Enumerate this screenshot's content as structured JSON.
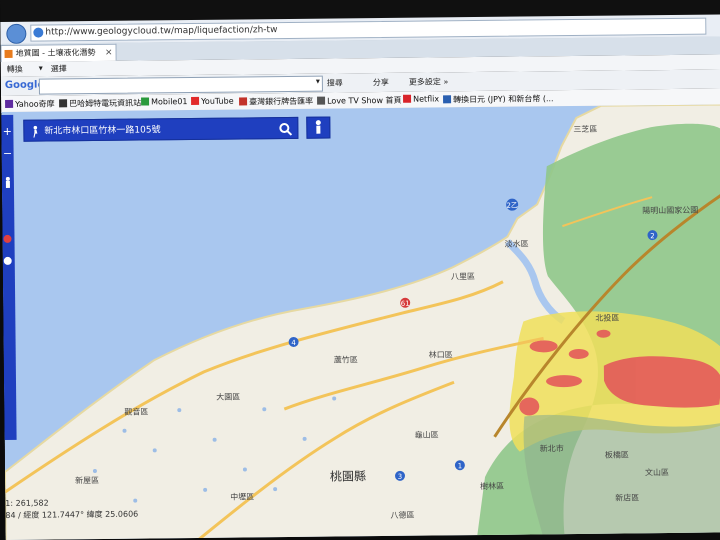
{
  "browser": {
    "url": "http://www.geologycloud.tw/map/liquefaction/zh-tw",
    "tab_title": "地質圖 - 土壤液化潛勢",
    "tab_close": "×"
  },
  "menu": {
    "items": [
      "轉換",
      "▾",
      "選擇"
    ]
  },
  "google_toolbar": {
    "logo": "Google",
    "search_dropdown": "▾",
    "search_label": "搜尋",
    "share_label": "分享",
    "more_label": "更多設定 »"
  },
  "favorites": [
    {
      "label": "Yahoo奇摩",
      "color": "#5f2ca0"
    },
    {
      "label": "巴哈姆特電玩資訊站",
      "color": "#333333"
    },
    {
      "label": "Mobile01",
      "color": "#2a9a3c"
    },
    {
      "label": "YouTube",
      "color": "#e22b2b"
    },
    {
      "label": "臺灣銀行牌告匯率",
      "color": "#c2332b"
    },
    {
      "label": "Love TV Show 首頁",
      "color": "#555555"
    },
    {
      "label": "Netflix",
      "color": "#d8232a"
    },
    {
      "label": "轉換日元 (JPY) 和新台幣 (...",
      "color": "#2a5fb0"
    }
  ],
  "map_ui": {
    "search_address": "新北市林口區竹林一路105號",
    "zoom_in": "+",
    "zoom_out": "−",
    "coords_line1": "1: 261,582",
    "coords_line2": "84 / 經度 121.7447° 緯度 25.0606"
  },
  "map_labels": {
    "sanzhi": "三芝區",
    "yangming_park": "陽明山國家公園",
    "tamsui": "淡水區",
    "bali": "八里區",
    "beitou": "北投區",
    "linkou": "林口區",
    "luzhu": "蘆竹區",
    "dayuan": "大園區",
    "guanyin": "觀音區",
    "xinwu": "新屋區",
    "guishan": "龜山區",
    "taoyuan_county": "桃園縣",
    "bade": "八德區",
    "zhongli": "中壢區",
    "banqiao": "板橋區",
    "shulin": "樹林區",
    "shin": "新北市",
    "xindian": "新店區",
    "wenshan": "文山區",
    "route_2": "2",
    "route_2a": "2乙",
    "route_61": "61",
    "route_4": "4",
    "route_1": "1",
    "route_3": "3",
    "route_15": "15"
  },
  "colors": {
    "sea": "#aac8f0",
    "land": "#f2efe6",
    "green_zone": "#8ec487",
    "yellow_risk": "#f2e35c",
    "red_risk": "#e85a5a",
    "highway": "#f5c65c",
    "map_panel": "#1f3fbf"
  }
}
